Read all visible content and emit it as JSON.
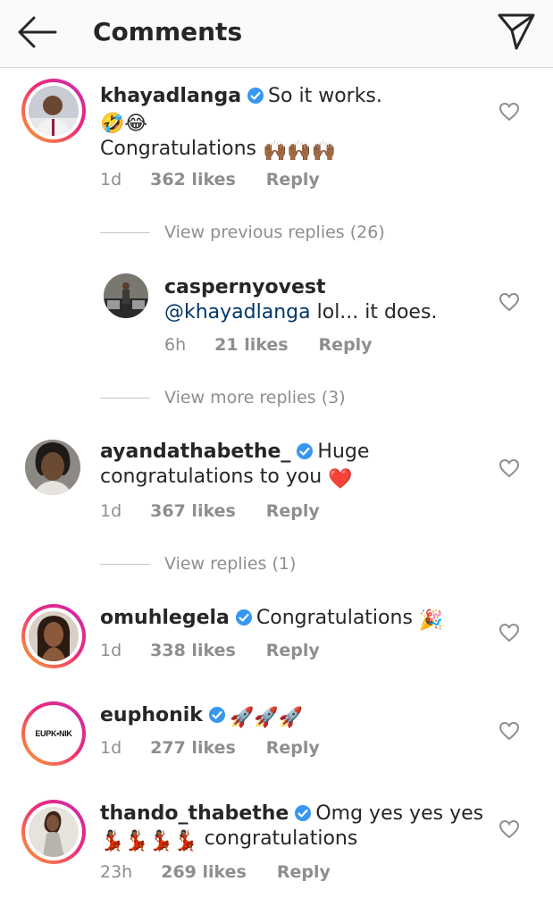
{
  "header": {
    "title": "Comments",
    "back_icon": "arrow-left-icon",
    "send_icon": "paper-plane-icon"
  },
  "colors": {
    "verified": "#3897f0",
    "meta": "#8e8e8e",
    "mention": "#00376b",
    "ring_start": "#f9a52a",
    "ring_end": "#c62cb0"
  },
  "comments": [
    {
      "username": "khayadlanga",
      "verified": true,
      "text": "So it works.",
      "emoji_line": "🤣😂",
      "text2": "Congratulations",
      "emoji2": "🙌🏾🙌🏾🙌🏾",
      "time": "1d",
      "likes": "362 likes",
      "reply": "Reply"
    },
    {
      "view_label": "View previous replies (26)"
    },
    {
      "username": "caspernyovest",
      "mention": "@khayadlanga",
      "text": " lol... it does.",
      "time": "6h",
      "likes": "21 likes",
      "reply": "Reply"
    },
    {
      "view_label": "View more replies (3)"
    },
    {
      "username": "ayandathabethe_",
      "verified": true,
      "text": "Huge",
      "text2": "congratulations to you",
      "emoji": "❤️",
      "time": "1d",
      "likes": "367 likes",
      "reply": "Reply"
    },
    {
      "view_label": "View replies (1)"
    },
    {
      "username": "omuhlegela",
      "verified": true,
      "text": "Congratulations",
      "emoji": "🎉",
      "time": "1d",
      "likes": "338 likes",
      "reply": "Reply"
    },
    {
      "username": "euphonik",
      "verified": true,
      "emoji": "🚀🚀🚀",
      "avatar_text": "EUPK•NIK",
      "time": "1d",
      "likes": "277 likes",
      "reply": "Reply"
    },
    {
      "username": "thando_thabethe",
      "verified": true,
      "text": "Omg yes yes yes",
      "emoji2": "💃🏾💃🏾💃🏾💃🏾",
      "text2": " congratulations",
      "time": "23h",
      "likes": "269 likes",
      "reply": "Reply"
    }
  ]
}
